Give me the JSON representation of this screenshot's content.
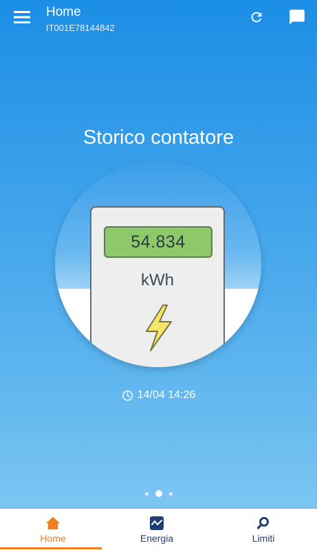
{
  "header": {
    "title": "Home",
    "subtitle": "IT001E78144842",
    "menu_icon": "hamburger-menu-icon",
    "refresh_icon": "refresh-icon",
    "chat_icon": "chat-icon"
  },
  "main": {
    "heading": "Storico contatore",
    "meter": {
      "reading": "54.834",
      "unit": "kWh",
      "icon": "lightning-bolt-icon"
    },
    "timestamp": "14/04 14:26",
    "pager": {
      "count": 3,
      "active_index": 1
    }
  },
  "bottom_nav": {
    "items": [
      {
        "label": "Home",
        "icon": "home-icon",
        "active": true
      },
      {
        "label": "Energia",
        "icon": "energy-chart-icon",
        "active": false
      },
      {
        "label": "Limiti",
        "icon": "search-icon",
        "active": false
      }
    ]
  },
  "colors": {
    "accent": "#f07f1e",
    "nav_text": "#1f3f73",
    "display_green": "#8dc96a",
    "background_top": "#1b8ee6",
    "background_bottom": "#7cc6f2"
  }
}
